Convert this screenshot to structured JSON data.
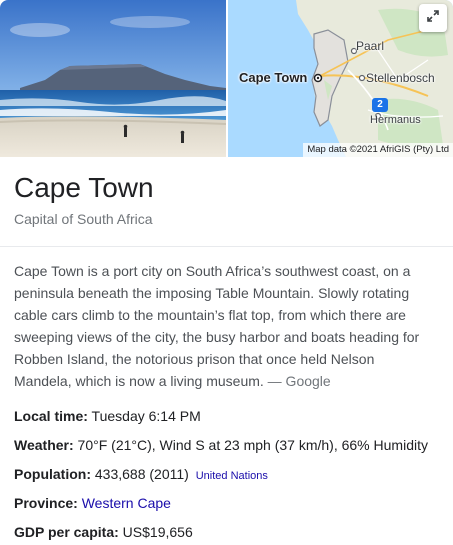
{
  "map": {
    "labels": {
      "paarl": "Paarl",
      "cape_town": "Cape Town",
      "stellenbosch": "Stellenbosch",
      "hermanus": "Hermanus"
    },
    "route_number": "2",
    "attribution": "Map data ©2021 AfriGIS (Pty) Ltd"
  },
  "header": {
    "title": "Cape Town",
    "subtitle": "Capital of South Africa"
  },
  "description": {
    "text": "Cape Town is a port city on South Africa’s southwest coast, on a peninsula beneath the imposing Table Mountain. Slowly rotating cable cars climb to the mountain’s flat top, from which there are sweeping views of the city, the busy harbor and boats heading for Robben Island, the notorious prison that once held Nelson Mandela, which is now a living museum.",
    "source": "— Google"
  },
  "facts": {
    "local_time": {
      "label": "Local time:",
      "value": "Tuesday 6:14 PM"
    },
    "weather": {
      "label": "Weather:",
      "value": "70°F (21°C), Wind S at 23 mph (37 km/h), 66% Humidity"
    },
    "population": {
      "label": "Population:",
      "value": "433,688 (2011)",
      "source_link": "United Nations"
    },
    "province": {
      "label": "Province:",
      "value": "Western Cape"
    },
    "gdp": {
      "label": "GDP per capita:",
      "value": "US$19,656"
    }
  },
  "colors": {
    "link": "#1a0dab",
    "text": "#202124",
    "muted": "#70757a",
    "map_water": "#aadaff",
    "map_land": "#e8eadc"
  },
  "icons": {
    "expand": "expand-arrows-icon",
    "map_marker": "city-marker-icon"
  }
}
